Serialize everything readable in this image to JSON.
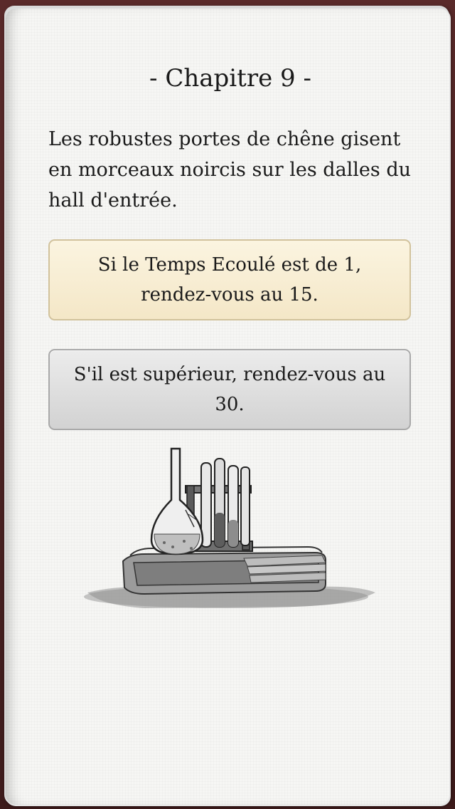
{
  "chapter": {
    "title": "- Chapitre 9 -"
  },
  "narrative": {
    "text": "Les robustes portes de chêne gisent en morceaux noircis sur les dalles du hall d'entrée."
  },
  "choices": [
    {
      "label": "Si le Temps Ecoulé est de 1, rendez-vous au 15."
    },
    {
      "label": "S'il est supérieur, rendez-vous au 30."
    }
  ],
  "illustration": {
    "icon": "alchemy-book-flask-illustration"
  },
  "colors": {
    "frame": "#4a2222",
    "page": "#f6f6f4",
    "choice_highlight": "#f4e7c7",
    "choice_default": "#d8d8d8"
  }
}
